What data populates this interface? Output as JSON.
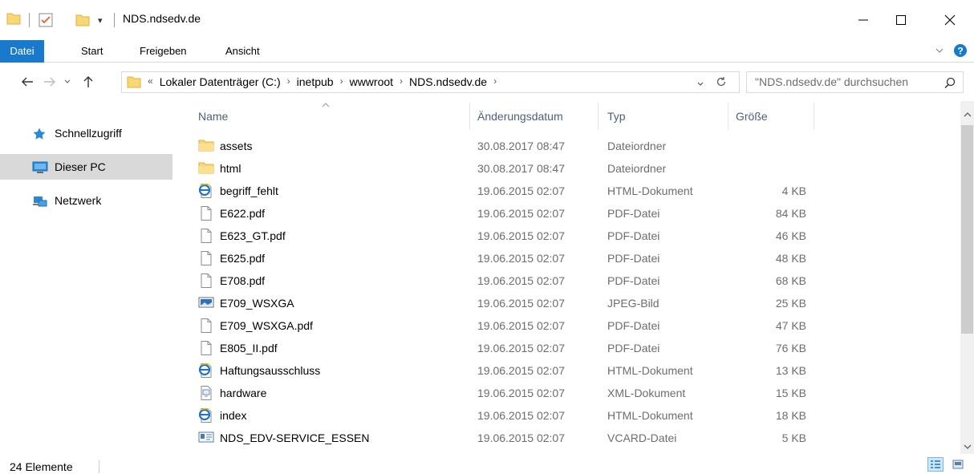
{
  "window": {
    "title": "NDS.ndsedv.de",
    "minimize_label": "—",
    "maximize_label": "☐",
    "close_label": "✕"
  },
  "ribbon": {
    "tabs": [
      "Datei",
      "Start",
      "Freigeben",
      "Ansicht"
    ],
    "accent": "#1979ca",
    "expand_icon": "chevron-down-icon",
    "help_icon": "help-icon"
  },
  "navigation": {
    "breadcrumb_overflow": "«",
    "breadcrumbs": [
      "Lokaler Datenträger (C:)",
      "inetpub",
      "wwwroot",
      "NDS.ndsedv.de"
    ],
    "search_placeholder": "\"NDS.ndsedv.de\" durchsuchen"
  },
  "sidebar": {
    "items": [
      {
        "label": "Schnellzugriff",
        "icon": "star-icon",
        "active": false
      },
      {
        "label": "Dieser PC",
        "icon": "computer-icon",
        "active": true
      },
      {
        "label": "Netzwerk",
        "icon": "network-icon",
        "active": false
      }
    ]
  },
  "columns": {
    "name": "Name",
    "date": "Änderungsdatum",
    "type": "Typ",
    "size": "Größe"
  },
  "files": [
    {
      "name": "assets",
      "date": "30.08.2017 08:47",
      "type": "Dateiordner",
      "size": "",
      "icon": "folder-icon"
    },
    {
      "name": "html",
      "date": "30.08.2017 08:47",
      "type": "Dateiordner",
      "size": "",
      "icon": "folder-icon"
    },
    {
      "name": "begriff_fehlt",
      "date": "19.06.2015 02:07",
      "type": "HTML-Dokument",
      "size": "4 KB",
      "icon": "ie-icon"
    },
    {
      "name": "E622.pdf",
      "date": "19.06.2015 02:07",
      "type": "PDF-Datei",
      "size": "84 KB",
      "icon": "file-icon"
    },
    {
      "name": "E623_GT.pdf",
      "date": "19.06.2015 02:07",
      "type": "PDF-Datei",
      "size": "46 KB",
      "icon": "file-icon"
    },
    {
      "name": "E625.pdf",
      "date": "19.06.2015 02:07",
      "type": "PDF-Datei",
      "size": "48 KB",
      "icon": "file-icon"
    },
    {
      "name": "E708.pdf",
      "date": "19.06.2015 02:07",
      "type": "PDF-Datei",
      "size": "68 KB",
      "icon": "file-icon"
    },
    {
      "name": "E709_WSXGA",
      "date": "19.06.2015 02:07",
      "type": "JPEG-Bild",
      "size": "25 KB",
      "icon": "image-icon"
    },
    {
      "name": "E709_WSXGA.pdf",
      "date": "19.06.2015 02:07",
      "type": "PDF-Datei",
      "size": "47 KB",
      "icon": "file-icon"
    },
    {
      "name": "E805_II.pdf",
      "date": "19.06.2015 02:07",
      "type": "PDF-Datei",
      "size": "76 KB",
      "icon": "file-icon"
    },
    {
      "name": "Haftungsausschluss",
      "date": "19.06.2015 02:07",
      "type": "HTML-Dokument",
      "size": "13 KB",
      "icon": "ie-icon"
    },
    {
      "name": "hardware",
      "date": "19.06.2015 02:07",
      "type": "XML-Dokument",
      "size": "15 KB",
      "icon": "xml-icon"
    },
    {
      "name": "index",
      "date": "19.06.2015 02:07",
      "type": "HTML-Dokument",
      "size": "18 KB",
      "icon": "ie-icon"
    },
    {
      "name": "NDS_EDV-SERVICE_ESSEN",
      "date": "19.06.2015 02:07",
      "type": "VCARD-Datei",
      "size": "5 KB",
      "icon": "vcard-icon"
    }
  ],
  "status": {
    "count": "24 Elemente"
  }
}
